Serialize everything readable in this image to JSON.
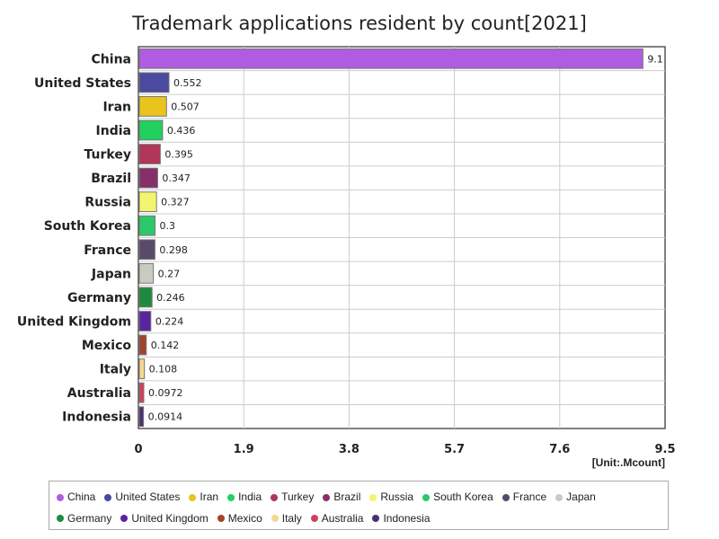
{
  "chart_data": {
    "type": "bar",
    "orientation": "horizontal",
    "title": "Trademark applications resident by count[2021]",
    "unit": "[Unit:.Mcount]",
    "xlim": [
      0,
      9.5
    ],
    "xticks": [
      "0",
      "1.9",
      "3.8",
      "5.7",
      "7.6",
      "9.5"
    ],
    "grid": true,
    "legend_position": "bottom",
    "categories": [
      "China",
      "United States",
      "Iran",
      "India",
      "Turkey",
      "Brazil",
      "Russia",
      "South Korea",
      "France",
      "Japan",
      "Germany",
      "United Kingdom",
      "Mexico",
      "Italy",
      "Australia",
      "Indonesia"
    ],
    "values": [
      9.1,
      0.552,
      0.507,
      0.436,
      0.395,
      0.347,
      0.327,
      0.3,
      0.298,
      0.27,
      0.246,
      0.224,
      0.142,
      0.108,
      0.0972,
      0.0914
    ],
    "value_labels": [
      "9.1",
      "0.552",
      "0.507",
      "0.436",
      "0.395",
      "0.347",
      "0.327",
      "0.3",
      "0.298",
      "0.27",
      "0.246",
      "0.224",
      "0.142",
      "0.108",
      "0.0972",
      "0.0914"
    ],
    "colors": [
      "#b05ce0",
      "#4a4aa0",
      "#e8c41c",
      "#22d060",
      "#b0365a",
      "#86306a",
      "#f4f46e",
      "#2cc86a",
      "#5a4a6a",
      "#c8ccc0",
      "#1e8a3e",
      "#5a24a0",
      "#a0442e",
      "#f4d890",
      "#d0405a",
      "#4a3070"
    ]
  }
}
